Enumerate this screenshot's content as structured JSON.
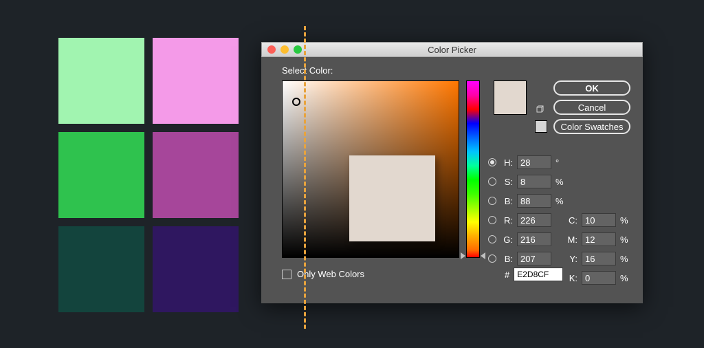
{
  "swatches": [
    "#a1f4b0",
    "#f49ae8",
    "#2fc24e",
    "#a6469a",
    "#13443d",
    "#2f1760"
  ],
  "divider_color": "#e8a33d",
  "dialog": {
    "title": "Color Picker",
    "select_label": "Select Color:",
    "buttons": {
      "ok": "OK",
      "cancel": "Cancel",
      "swatches": "Color Swatches"
    },
    "selected_radio": "H",
    "hsb": {
      "H": "28",
      "S": "8",
      "B": "88"
    },
    "hsb_unit": {
      "H": "°",
      "S": "%",
      "B": "%"
    },
    "rgb": {
      "R": "226",
      "G": "216",
      "B": "207"
    },
    "cmyk": {
      "C": "10",
      "M": "12",
      "Y": "16",
      "K": "0"
    },
    "cmyk_unit": "%",
    "hex_prefix": "#",
    "hex": "E2D8CF",
    "web_only_label": "Only Web Colors",
    "labels": {
      "H": "H:",
      "S": "S:",
      "B": "B:",
      "R": "R:",
      "G": "G:",
      "Bb": "B:",
      "C": "C:",
      "M": "M:",
      "Y": "Y:",
      "K": "K:"
    }
  }
}
